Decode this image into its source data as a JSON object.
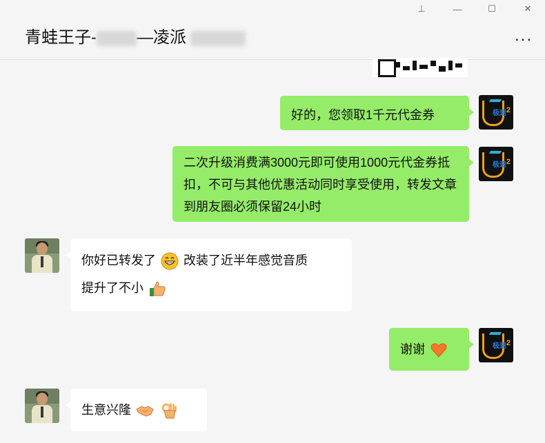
{
  "window": {
    "title_part1": "青蛙王子-",
    "title_part2": "—凌派",
    "more_label": "...",
    "controls": {
      "pin_glyph": "⊥",
      "minimize_glyph": "—",
      "maximize_glyph": "☐",
      "close_glyph": "✕"
    }
  },
  "messages": [
    {
      "sender": "self",
      "avatar": "brand-logo",
      "text": "好的，您领取1千元代金券"
    },
    {
      "sender": "self",
      "avatar": "brand-logo",
      "text": "二次升级消费满3000元即可使用1000元代金券抵扣，不可与其他优惠活动同时享受使用，转发文章到朋友圈必须保留24小时"
    },
    {
      "sender": "other",
      "avatar": "person-photo",
      "text_a": "你好已转发了",
      "emoji_a": "grinning-face",
      "text_b": "改装了近半年感觉音质",
      "text_c": "提升了不小",
      "emoji_b": "thumbs-up"
    },
    {
      "sender": "self",
      "avatar": "brand-logo",
      "text": "谢谢",
      "emoji": "orange-heart"
    },
    {
      "sender": "other",
      "avatar": "person-photo",
      "text": "生意兴隆",
      "emoji_a": "handshake",
      "emoji_b": "ok-hand"
    }
  ],
  "brand_avatar": {
    "text": "极速",
    "num": "2"
  },
  "colors": {
    "self_bubble": "#95ec69",
    "other_bubble": "#ffffff",
    "background": "#f5f5f5"
  }
}
